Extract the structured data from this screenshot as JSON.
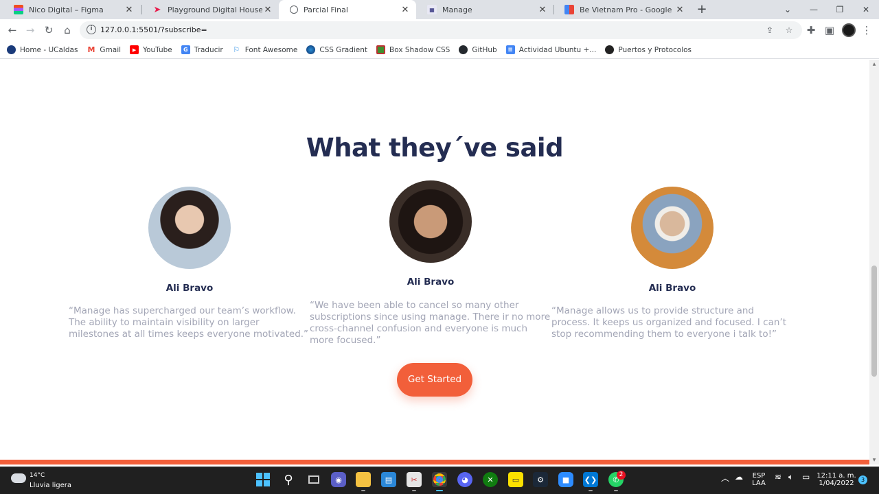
{
  "browser": {
    "tabs": [
      {
        "title": "Nico Digital – Figma",
        "icon": "figma-icon",
        "color": "#a259ff",
        "active": false
      },
      {
        "title": "Playground Digital House",
        "icon": "dh-icon",
        "color": "#e81e4d",
        "active": false
      },
      {
        "title": "Parcial Final",
        "icon": "globe-icon",
        "color": "#5f6368",
        "active": true
      },
      {
        "title": "Manage",
        "icon": "manage-icon",
        "color": "#1a1a6e",
        "active": false
      },
      {
        "title": "Be Vietnam Pro - Google Fonts",
        "icon": "google-fonts-icon",
        "color": "#4285f4",
        "active": false
      }
    ],
    "url": "127.0.0.1:5501/?subscribe=",
    "bookmarks": [
      {
        "label": "Home - UCaldas",
        "color": "#1a3a7a"
      },
      {
        "label": "Gmail",
        "color": "#ea4335"
      },
      {
        "label": "YouTube",
        "color": "#ff0000"
      },
      {
        "label": "Traducir",
        "color": "#4285f4"
      },
      {
        "label": "Font Awesome",
        "color": "#228ae6"
      },
      {
        "label": "CSS Gradient",
        "color": "#0b5fa5"
      },
      {
        "label": "Box Shadow CSS",
        "color": "#3f8f2f"
      },
      {
        "label": "GitHub",
        "color": "#24292e"
      },
      {
        "label": "Actividad Ubuntu +...",
        "color": "#4285f4"
      },
      {
        "label": "Puertos y Protocolos",
        "color": "#222222"
      }
    ]
  },
  "page": {
    "section_title": "What they´ve said",
    "testimonials": [
      {
        "name": "Ali Bravo",
        "quote": "“Manage has supercharged our team’s workflow. The ability to maintain visibility on larger milestones at all times keeps everyone motivated.”"
      },
      {
        "name": "Ali Bravo",
        "quote": "“We have been able to cancel so many other subscriptions since using manage. There ir no more cross-channel confusion and everyone is much more focused.”"
      },
      {
        "name": "Ali Bravo",
        "quote": "“Manage allows us to provide structure and process. It keeps us organized and focused. I can’t stop recommending them to everyone i talk to!”"
      }
    ],
    "cta_label": "Get Started",
    "accent_color": "#f25f3a",
    "heading_color": "#242d52"
  },
  "taskbar": {
    "weather_temp": "14°C",
    "weather_desc": "Lluvia ligera",
    "whatsapp_badge": "2",
    "lang_top": "ESP",
    "lang_bottom": "LAA",
    "time": "12:11 a. m.",
    "date": "1/04/2022",
    "notifications": "3"
  }
}
